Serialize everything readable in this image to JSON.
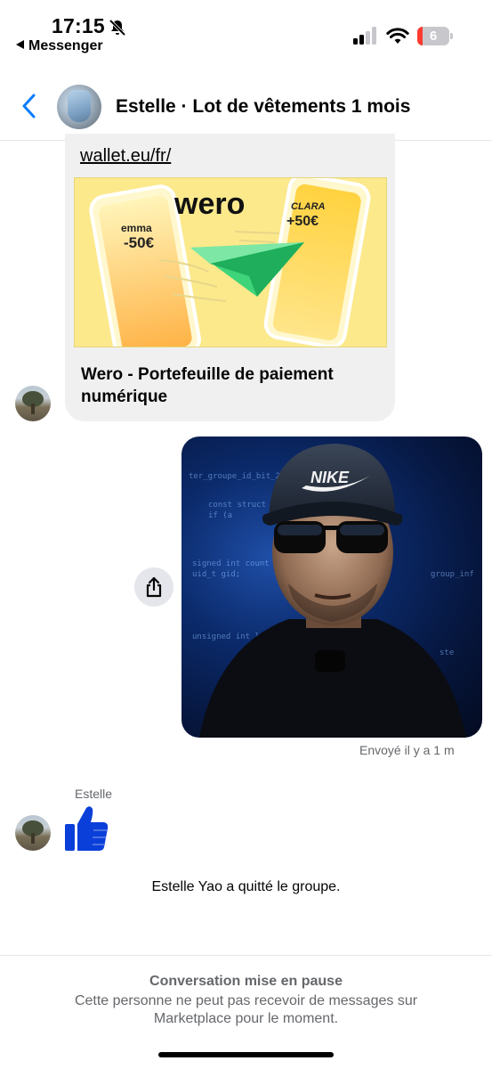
{
  "status_bar": {
    "time": "17:15",
    "back_app": "Messenger",
    "battery": "6",
    "icons": [
      "bell-slash-icon",
      "signal-icon",
      "wifi-icon",
      "battery-icon"
    ]
  },
  "header": {
    "title": "Estelle · Lot de vêtements 1 mois",
    "back_icon": "chevron-left-icon"
  },
  "link_card": {
    "url": "wallet.eu/fr/",
    "title": "Wero - Portefeuille de paiement numérique",
    "image": {
      "brand": "wero",
      "left_name": "emma",
      "left_amount": "-50€",
      "right_name": "CLARA",
      "right_amount": "+50€"
    }
  },
  "photo_message": {
    "cap_logo": "NIKE",
    "sent_status": "Envoyé il y a 1 m",
    "share_icon": "share-icon"
  },
  "like_message": {
    "sender": "Estelle",
    "icon": "thumbs-up-icon"
  },
  "system_message": "Estelle Yao a quitté le groupe.",
  "footer": {
    "title": "Conversation mise en pause",
    "text": "Cette personne ne peut pas recevoir de messages sur Marketplace pour le moment."
  },
  "colors": {
    "accent": "#0a7cff",
    "like": "#0a3fd9",
    "wero_bg": "#fbe98c",
    "secondary_text": "#65676b"
  }
}
